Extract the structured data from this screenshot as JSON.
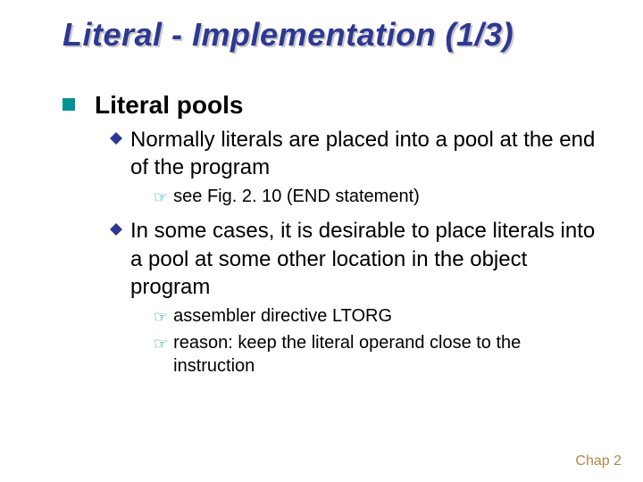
{
  "title": "Literal - Implementation (1/3)",
  "lvl1_heading": "Literal pools",
  "sub1": "Normally literals are placed into a pool at the end of the program",
  "sub1_a": "see Fig. 2. 10 (END statement)",
  "sub2": "In some cases, it is desirable to place literals into a pool at some other location in the object program",
  "sub2_a": "assembler directive LTORG",
  "sub2_b": "reason: keep the literal operand close to the instruction",
  "footer": "Chap 2"
}
